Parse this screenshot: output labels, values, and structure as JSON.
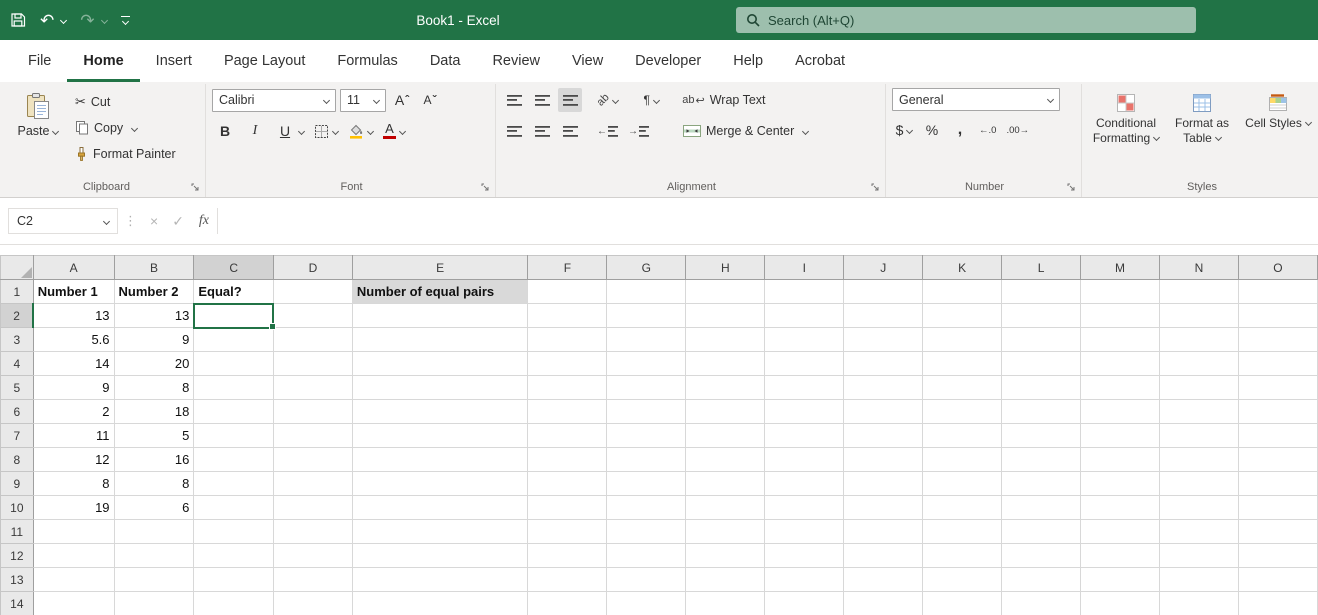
{
  "colors": {
    "excel_green": "#217346",
    "font_red": "#c00000",
    "fill_yellow": "#ffc000"
  },
  "titlebar": {
    "title": "Book1  -  Excel",
    "search_placeholder": "Search (Alt+Q)"
  },
  "menubar": {
    "items": [
      "File",
      "Home",
      "Insert",
      "Page Layout",
      "Formulas",
      "Data",
      "Review",
      "View",
      "Developer",
      "Help",
      "Acrobat"
    ],
    "active": "Home"
  },
  "ribbon": {
    "clipboard": {
      "label": "Clipboard",
      "paste": "Paste",
      "cut": "Cut",
      "copy": "Copy",
      "format_painter": "Format Painter"
    },
    "font": {
      "label": "Font",
      "family": "Calibri",
      "size": "11"
    },
    "alignment": {
      "label": "Alignment",
      "wrap_text": "Wrap Text",
      "merge_center": "Merge & Center"
    },
    "number": {
      "label": "Number",
      "format": "General"
    },
    "styles": {
      "label": "Styles",
      "conditional_formatting": "Conditional Formatting",
      "format_as_table": "Format as Table",
      "cell_styles": "Cell Styles"
    }
  },
  "icons": {
    "cut": "✂",
    "bold": "B",
    "italic": "I",
    "underline": "U",
    "grow_font": "A",
    "shrink_font": "A",
    "grow_caret": "ˆ",
    "shrink_caret": "ˇ",
    "font_color_letter": "A",
    "ab": "ab",
    "wrap_arrow": "↩",
    "paragraph": "¶",
    "indent_left_arrow": "←",
    "indent_right_arrow": "→",
    "dollar": "$",
    "percent": "%",
    "comma": ",",
    "increase_decimal": "←.0",
    "decrease_decimal": ".00→",
    "fx": "fx",
    "close": "×",
    "check": "✓",
    "dots": "⋮"
  },
  "formula_bar": {
    "name_box": "C2",
    "formula": ""
  },
  "spreadsheet": {
    "selected_cell": "C2",
    "selected_column": "C",
    "selected_row": 2,
    "row_header_width": 33,
    "row_count": 14,
    "columns": [
      {
        "label": "A",
        "width": 81
      },
      {
        "label": "B",
        "width": 80
      },
      {
        "label": "C",
        "width": 80
      },
      {
        "label": "D",
        "width": 80
      },
      {
        "label": "E",
        "width": 176
      },
      {
        "label": "F",
        "width": 80
      },
      {
        "label": "G",
        "width": 80
      },
      {
        "label": "H",
        "width": 80
      },
      {
        "label": "I",
        "width": 80
      },
      {
        "label": "J",
        "width": 80
      },
      {
        "label": "K",
        "width": 80
      },
      {
        "label": "L",
        "width": 80
      },
      {
        "label": "M",
        "width": 80
      },
      {
        "label": "N",
        "width": 80
      },
      {
        "label": "O",
        "width": 80
      }
    ],
    "cells": [
      {
        "ref": "A1",
        "value": "Number 1",
        "bold": true
      },
      {
        "ref": "B1",
        "value": "Number 2",
        "bold": true
      },
      {
        "ref": "C1",
        "value": "Equal?",
        "bold": true
      },
      {
        "ref": "E1",
        "value": "Number of equal pairs",
        "bold": true,
        "fill": "#d9d9d9"
      },
      {
        "ref": "A2",
        "value": "13",
        "num": true
      },
      {
        "ref": "B2",
        "value": "13",
        "num": true
      },
      {
        "ref": "A3",
        "value": "5.6",
        "num": true
      },
      {
        "ref": "B3",
        "value": "9",
        "num": true
      },
      {
        "ref": "A4",
        "value": "14",
        "num": true
      },
      {
        "ref": "B4",
        "value": "20",
        "num": true
      },
      {
        "ref": "A5",
        "value": "9",
        "num": true
      },
      {
        "ref": "B5",
        "value": "8",
        "num": true
      },
      {
        "ref": "A6",
        "value": "2",
        "num": true
      },
      {
        "ref": "B6",
        "value": "18",
        "num": true
      },
      {
        "ref": "A7",
        "value": "11",
        "num": true
      },
      {
        "ref": "B7",
        "value": "5",
        "num": true
      },
      {
        "ref": "A8",
        "value": "12",
        "num": true
      },
      {
        "ref": "B8",
        "value": "16",
        "num": true
      },
      {
        "ref": "A9",
        "value": "8",
        "num": true
      },
      {
        "ref": "B9",
        "value": "8",
        "num": true
      },
      {
        "ref": "A10",
        "value": "19",
        "num": true
      },
      {
        "ref": "B10",
        "value": "6",
        "num": true
      }
    ]
  }
}
